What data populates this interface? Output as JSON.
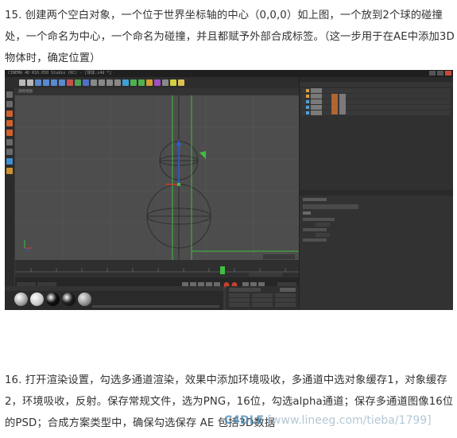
{
  "paragraphs": {
    "step15": "15. 创建两个空白对象，一个位于世界坐标轴的中心（0,0,0）如上图，一个放到2个球的碰撞处，一个命名为中心，一个命名为碰撞，并且都赋予外部合成标签。（这一步用于在AE中添加3D 物体时，确定位置）",
    "step16": "16. 打开渲染设置，勾选多通道渲染，效果中添加环境吸收，多通道中选对象缓存1，对象缓存2，环境吸收，反射。保存常规文件，选为PNG，16位，勾选alpha通道；保存多通道图像16位的PSD；合成方案类型中，确保勾选保存 AE 包括3D数据"
  },
  "screenshot": {
    "window_title": "CINEMA 4D R16.050 Studio (RC) - [球体.c4d *]",
    "viewport_label": "透视视图",
    "colors": {
      "viewport_bg": "#4d4d4d",
      "panel_bg": "#303030",
      "axis_green": "#3fbf3f",
      "axis_blue": "#2a5fd8",
      "axis_red": "#d83a2a"
    }
  },
  "watermark": {
    "logo": "C4DLE",
    "url": "[www.lineeg.com/tieba/1799]"
  }
}
